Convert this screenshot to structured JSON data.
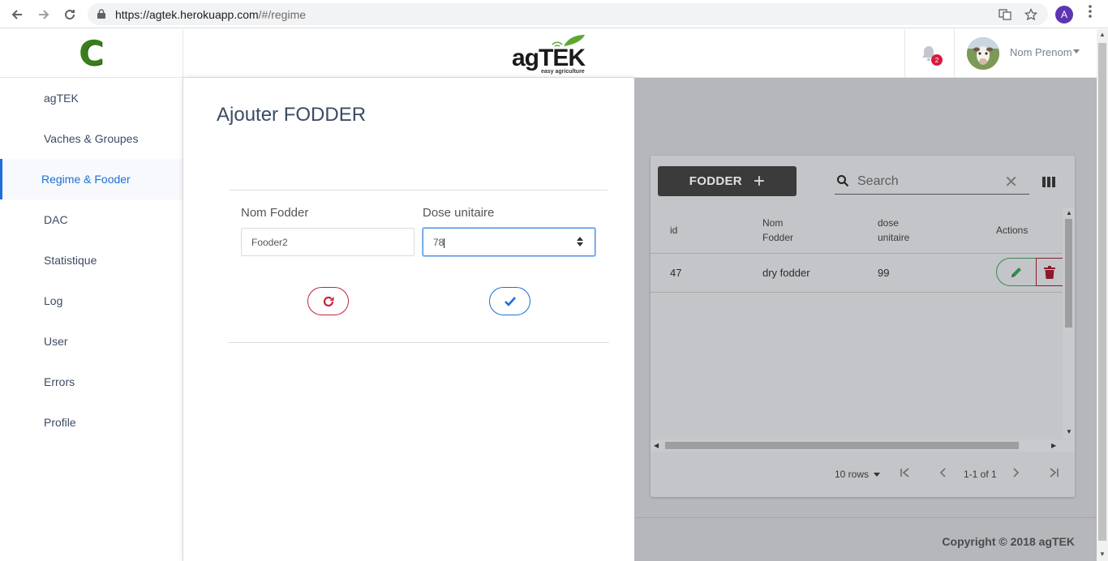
{
  "browser": {
    "url_host": "https://agtek.herokuapp.com",
    "url_path": "/#/regime"
  },
  "sidebar": {
    "brand_letter": "C",
    "items": [
      {
        "label": "agTEK"
      },
      {
        "label": "Vaches & Groupes"
      },
      {
        "label": "Regime & Fooder",
        "active": true
      },
      {
        "label": "DAC"
      },
      {
        "label": "Statistique"
      },
      {
        "label": "Log"
      },
      {
        "label": "User"
      },
      {
        "label": "Errors"
      },
      {
        "label": "Profile"
      }
    ]
  },
  "header": {
    "logo_text": "agTEK",
    "logo_sub": "easy agriculture",
    "notifications": "2",
    "user_name": "Nom Prenom",
    "avatar_letter": "A"
  },
  "form": {
    "title": "Ajouter FODDER",
    "name_label": "Nom Fodder",
    "name_value": "Fooder2",
    "dose_label": "Dose unitaire",
    "dose_value": "78"
  },
  "table": {
    "add_button": "FODDER",
    "search_placeholder": "Search",
    "headers": {
      "id": "id",
      "nom_line1": "Nom",
      "nom_line2": "Fodder",
      "dose_line1": "dose",
      "dose_line2": "unitaire",
      "actions": "Actions"
    },
    "rows": [
      {
        "id": "47",
        "nom": "dry fodder",
        "dose": "99"
      }
    ],
    "rows_per_page": "10 rows",
    "page_info": "1-1 of 1"
  },
  "footer": {
    "copyright": "Copyright © 2018 agTEK"
  },
  "colors": {
    "accent": "#1e6fd9",
    "danger": "#c0263b",
    "success": "#3a8a4e",
    "overlay": "#b6b7ba"
  }
}
